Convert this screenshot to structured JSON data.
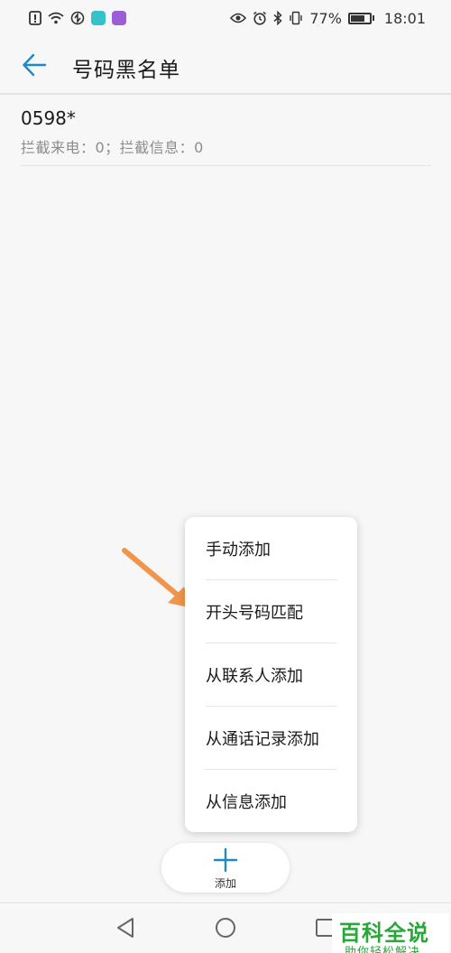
{
  "status_bar": {
    "battery": "77%",
    "time": "18:01",
    "battery_level": 0.77,
    "left_icons": [
      "warning-icon",
      "wifi-icon",
      "sync-icon",
      "app-icon-teal",
      "app-icon-purple"
    ],
    "right_icons": [
      "eye-icon",
      "alarm-icon",
      "bluetooth-icon",
      "vibrate-icon",
      "battery-icon"
    ]
  },
  "header": {
    "title": "号码黑名单",
    "back_icon": "arrow-left-icon",
    "accent_color": "#1e88c8"
  },
  "blacklist": [
    {
      "number": "0598*",
      "stats": "拦截来电：0；拦截信息：0"
    }
  ],
  "menu": {
    "items": [
      {
        "label": "手动添加"
      },
      {
        "label": "开头号码匹配"
      },
      {
        "label": "从联系人添加"
      },
      {
        "label": "从通话记录添加"
      },
      {
        "label": "从信息添加"
      }
    ]
  },
  "annotation": {
    "arrow_color": "#f0954a"
  },
  "add_button": {
    "label": "添加",
    "icon": "plus-icon"
  },
  "nav": {
    "icons": [
      "back-triangle-icon",
      "home-circle-icon",
      "recents-square-icon"
    ]
  },
  "watermark": {
    "title": "百科全说",
    "subtitle": "助你轻松解决",
    "color": "#2aa63b"
  }
}
